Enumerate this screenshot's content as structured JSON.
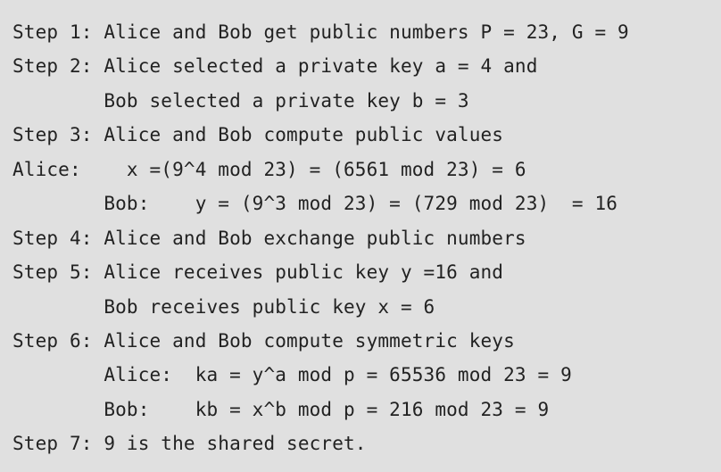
{
  "lines": [
    "Step 1: Alice and Bob get public numbers P = 23, G = 9",
    "Step 2: Alice selected a private key a = 4 and",
    "        Bob selected a private key b = 3",
    "Step 3: Alice and Bob compute public values",
    "Alice:    x =(9^4 mod 23) = (6561 mod 23) = 6",
    "        Bob:    y = (9^3 mod 23) = (729 mod 23)  = 16",
    "Step 4: Alice and Bob exchange public numbers",
    "Step 5: Alice receives public key y =16 and",
    "        Bob receives public key x = 6",
    "Step 6: Alice and Bob compute symmetric keys",
    "        Alice:  ka = y^a mod p = 65536 mod 23 = 9",
    "        Bob:    kb = x^b mod p = 216 mod 23 = 9",
    "Step 7: 9 is the shared secret."
  ]
}
